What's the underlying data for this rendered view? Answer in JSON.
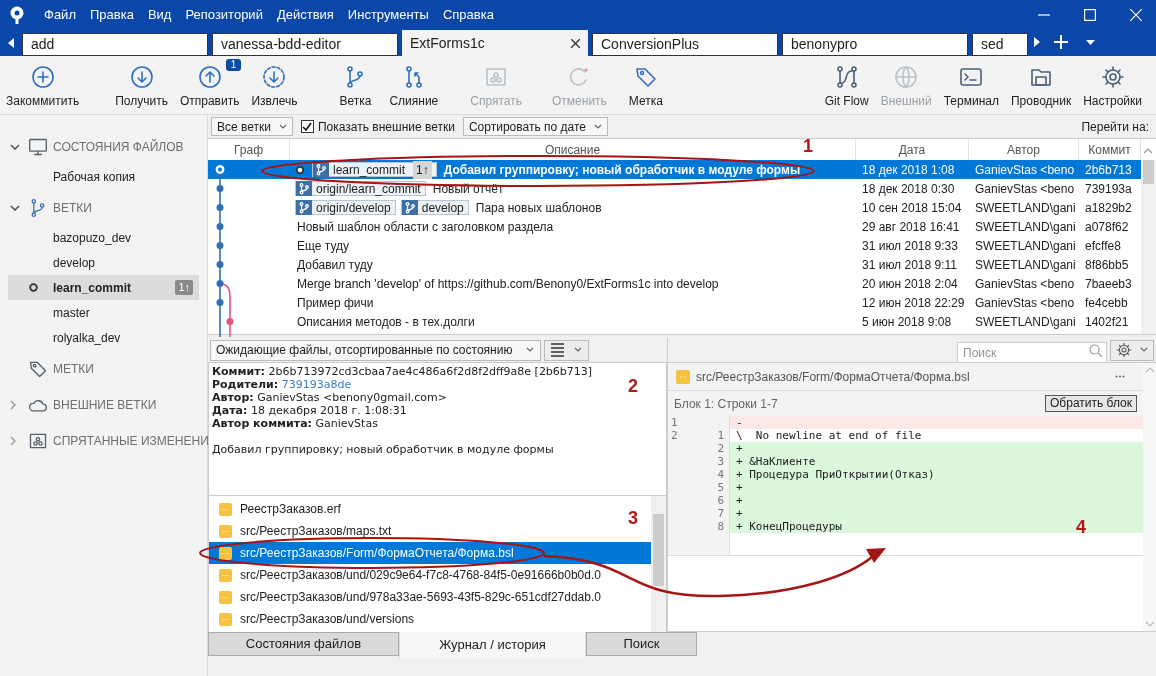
{
  "window": {
    "menu": [
      "Файл",
      "Правка",
      "Вид",
      "Репозиторий",
      "Действия",
      "Инструменты",
      "Справка"
    ]
  },
  "tabs": [
    {
      "label": "add",
      "selected": false
    },
    {
      "label": "vanessa-bdd-editor",
      "selected": false
    },
    {
      "label": "ExtForms1c",
      "selected": true
    },
    {
      "label": "ConversionPlus",
      "selected": false
    },
    {
      "label": "benonypro",
      "selected": false
    },
    {
      "label": "sed",
      "selected": false
    }
  ],
  "toolbar_left": [
    {
      "label": "Закоммитить",
      "kind": "commit",
      "disabled": false
    },
    {
      "label": "Получить",
      "kind": "pull",
      "disabled": false
    },
    {
      "label": "Отправить",
      "kind": "push",
      "disabled": false,
      "badge": "1"
    },
    {
      "label": "Извлечь",
      "kind": "fetch",
      "disabled": false
    },
    {
      "label": "Ветка",
      "kind": "branch",
      "disabled": false
    },
    {
      "label": "Слияние",
      "kind": "merge",
      "disabled": false
    },
    {
      "label": "Спрятать",
      "kind": "stash",
      "disabled": true
    },
    {
      "label": "Отменить",
      "kind": "discard",
      "disabled": true
    },
    {
      "label": "Метка",
      "kind": "tag",
      "disabled": false
    }
  ],
  "toolbar_right": [
    {
      "label": "Git Flow",
      "kind": "gitflow",
      "disabled": false
    },
    {
      "label": "Внешний",
      "kind": "remote",
      "disabled": true
    },
    {
      "label": "Терминал",
      "kind": "terminal",
      "disabled": false
    },
    {
      "label": "Проводник",
      "kind": "explorer",
      "disabled": false
    },
    {
      "label": "Настройки",
      "kind": "settings",
      "disabled": false
    }
  ],
  "sidebar": [
    {
      "label": "СОСТОЯНИЯ ФАЙЛОВ",
      "kind": "monitor",
      "expandable": true,
      "expanded": true,
      "children": [
        {
          "label": "Рабочая копия",
          "selected": false,
          "current": false
        }
      ]
    },
    {
      "label": "ВЕТКИ",
      "kind": "branch",
      "expandable": true,
      "expanded": true,
      "children": [
        {
          "label": "bazopuzo_dev",
          "selected": false,
          "current": false
        },
        {
          "label": "develop",
          "selected": false,
          "current": false
        },
        {
          "label": "learn_commit",
          "selected": true,
          "current": true,
          "badge": "1↑"
        },
        {
          "label": "master",
          "selected": false,
          "current": false
        },
        {
          "label": "rolyalka_dev",
          "selected": false,
          "current": false
        }
      ]
    },
    {
      "label": "МЕТКИ",
      "kind": "tag",
      "expandable": false
    },
    {
      "label": "ВНЕШНИЕ ВЕТКИ",
      "kind": "cloud",
      "expandable": true,
      "expanded": false
    },
    {
      "label": "СПРЯТАННЫЕ ИЗМЕНЕНИ",
      "kind": "stash",
      "expandable": true,
      "expanded": false
    }
  ],
  "filter": {
    "branches": "Все ветки",
    "show_remote": {
      "label": "Показать внешние ветки",
      "checked": true
    },
    "sort": "Сортировать по дате",
    "jump_label": "Перейти на:"
  },
  "commits": {
    "columns": [
      "Граф",
      "Описание",
      "Дата",
      "Автор",
      "Коммит"
    ],
    "rows": [
      {
        "head": true,
        "refs": [
          {
            "name": "learn_commit",
            "badge": "1↑"
          }
        ],
        "message": "Добавил группировку; новый обработчик в модуле формы",
        "date": "18 дек 2018 1:08",
        "author": "GanievStas <beno",
        "hash": "2b6b713",
        "selected": true
      },
      {
        "head": false,
        "refs": [
          {
            "name": "origin/learn_commit"
          }
        ],
        "message": "Новый отчёт",
        "date": "18 дек 2018 0:30",
        "author": "GanievStas <beno",
        "hash": "739193a",
        "selected": false
      },
      {
        "head": false,
        "refs": [
          {
            "name": "origin/develop"
          },
          {
            "name": "develop"
          }
        ],
        "message": "Пара новых шаблонов",
        "date": "10 сен 2018 15:04",
        "author": "SWEETLAND\\gani",
        "hash": "a1829b2",
        "selected": false
      },
      {
        "head": false,
        "message": "Новый шаблон области с заголовком раздела",
        "date": "29 авг 2018 16:41",
        "author": "SWEETLAND\\gani",
        "hash": "a078f62",
        "selected": false
      },
      {
        "head": false,
        "message": "Еще туду",
        "date": "31 июл 2018 9:33",
        "author": "SWEETLAND\\gani",
        "hash": "efcffe8",
        "selected": false
      },
      {
        "head": false,
        "message": "Добавил туду",
        "date": "31 июл 2018 9:11",
        "author": "SWEETLAND\\gani",
        "hash": "8f86bb5",
        "selected": false
      },
      {
        "head": false,
        "message": "Merge branch 'develop' of https://github.com/Benony0/ExtForms1c into develop",
        "date": "20 июн 2018 2:04",
        "author": "GanievStas <beno",
        "hash": "7baeeb3",
        "selected": false
      },
      {
        "head": false,
        "message": "Пример фичи",
        "date": "12 июн 2018 22:29",
        "author": "GanievStas <beno",
        "hash": "fe4cebb",
        "selected": false
      },
      {
        "head": false,
        "message": "Описания методов - в тех.долги",
        "date": "5 июн 2018 9:08",
        "author": "SWEETLAND\\gani",
        "hash": "1402f21",
        "selected": false
      }
    ]
  },
  "files_bar": {
    "dropdown": "Ожидающие файлы, отсортированные по состоянию",
    "search_placeholder": "Поиск"
  },
  "details": {
    "fields": [
      {
        "label": "Коммит:",
        "value": "2b6b713972cd3cbaa7ae4c486a6f2d8f2dff9a8e [2b6b713]",
        "kind": "text"
      },
      {
        "label": "Родители:",
        "value": "739193a8de",
        "kind": "link"
      },
      {
        "label": "Автор:",
        "value": "GanievStas <benony0gmail.com>",
        "kind": "text"
      },
      {
        "label": "Дата:",
        "value": "18 декабря 2018 г. 1:08:31",
        "kind": "text"
      },
      {
        "label": "Автор коммита:",
        "value": "GanievStas",
        "kind": "text"
      }
    ],
    "message": "Добавил группировку; новый обработчик в модуле формы"
  },
  "files": [
    {
      "path": "РеестрЗаказов.erf",
      "selected": false
    },
    {
      "path": "src/РеестрЗаказов/maps.txt",
      "selected": false
    },
    {
      "path": "src/РеестрЗаказов/Form/ФормаОтчета/Форма.bsl",
      "selected": true
    },
    {
      "path": "src/РеестрЗаказов/und/029c9e64-f7c8-4768-84f5-0e91666b0b0d.0",
      "selected": false
    },
    {
      "path": "src/РеестрЗаказов/und/978a33ae-5693-43f5-829c-651cdf27ddab.0",
      "selected": false
    },
    {
      "path": "src/РеестрЗаказов/und/versions",
      "selected": false
    }
  ],
  "diff": {
    "path": "src/РеестрЗаказов/Form/ФормаОтчета/Форма.bsl",
    "block": "Блок 1: Строки 1-7",
    "button": "Обратить блок",
    "lines": [
      {
        "old": "1",
        "text": "-",
        "kind": "removed"
      },
      {
        "old": "2",
        "new": "1",
        "text": "\\  No newline at end of file",
        "kind": "context"
      },
      {
        "new": "2",
        "text": "+",
        "kind": "added"
      },
      {
        "new": "3",
        "text": "+ &НаКлиенте",
        "kind": "added"
      },
      {
        "new": "4",
        "text": "+ Процедура ПриОткрытии(Отказ)",
        "kind": "added"
      },
      {
        "new": "5",
        "text": "+",
        "kind": "added"
      },
      {
        "new": "6",
        "text": "+",
        "kind": "added"
      },
      {
        "new": "7",
        "text": "+",
        "kind": "added"
      },
      {
        "new": "8",
        "text": "+ КонецПроцедуры",
        "kind": "added"
      }
    ]
  },
  "bottom_tabs": [
    {
      "label": "Состояния файлов",
      "selected": false
    },
    {
      "label": "Журнал / история",
      "selected": true
    },
    {
      "label": "Поиск",
      "selected": false
    }
  ],
  "annotations": [
    "1",
    "2",
    "3",
    "4"
  ]
}
